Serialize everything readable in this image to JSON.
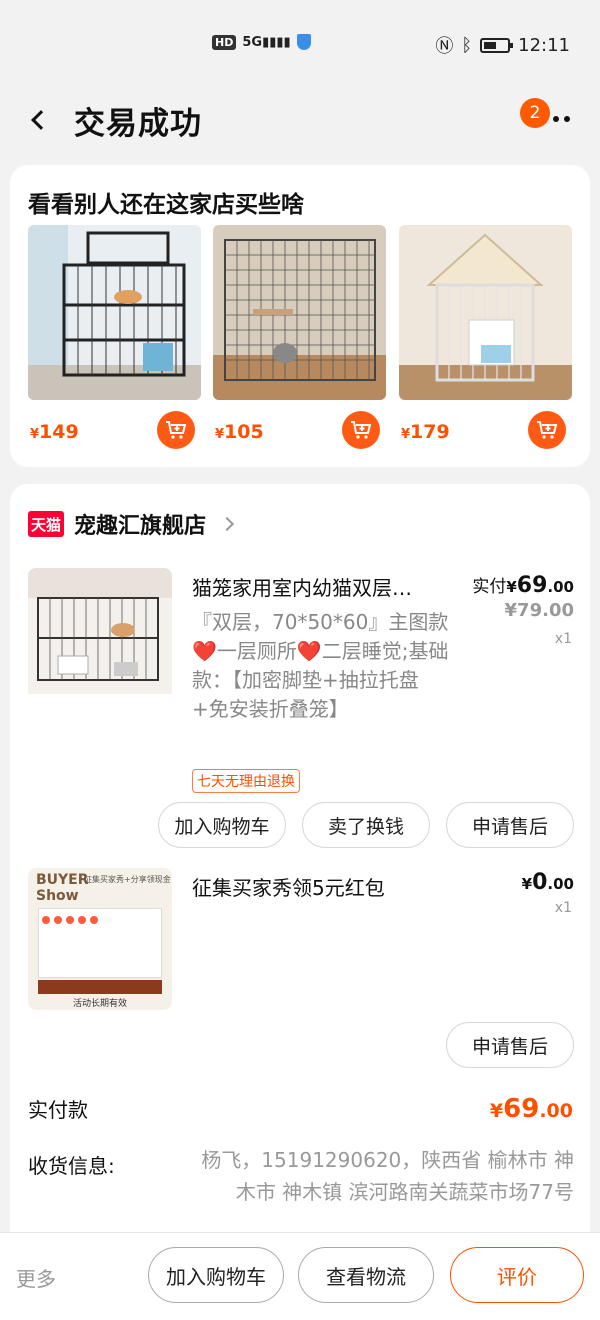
{
  "status_bar": {
    "time": "12:11",
    "network": "5G",
    "hd": "HD"
  },
  "nav": {
    "title": "交易成功",
    "notification_count": "2"
  },
  "recommend": {
    "title": "看看别人还在这家店买些啥",
    "items": [
      {
        "currency": "¥",
        "price": "149"
      },
      {
        "currency": "¥",
        "price": "105"
      },
      {
        "currency": "¥",
        "price": "179"
      }
    ]
  },
  "shop": {
    "logo_text": "天猫",
    "name": "宠趣汇旗舰店"
  },
  "products": [
    {
      "title": "猫笼家用室内幼猫双层…",
      "spec": "『双层，70*50*60』主图款❤️一层厕所❤️二层睡觉;基础款：【加密脚垫+抽拉托盘+免安装折叠笼】",
      "paid_label": "实付",
      "paid_currency": "¥",
      "paid_int": "69",
      "paid_dec": ".00",
      "original_price": "¥79.00",
      "qty": "x1",
      "return_tag": "七天无理由退换",
      "actions": [
        "加入购物车",
        "卖了换钱",
        "申请售后"
      ]
    },
    {
      "title": "征集买家秀领5元红包",
      "paid_currency": "¥",
      "paid_int": "0",
      "paid_dec": ".00",
      "qty": "x1",
      "thumb_text": {
        "line1": "BUYER",
        "line2": "Show",
        "caption": "征集买家秀+分享领现金",
        "footer": "活动长期有效"
      },
      "actions": [
        "申请售后"
      ]
    }
  ],
  "payment": {
    "label": "实付款",
    "currency": "¥",
    "amount_int": "69",
    "amount_dec": ".00"
  },
  "shipping": {
    "label": "收货信息:",
    "value": "杨飞，15191290620，陕西省 榆林市 神木市 神木镇 滨河路南关蔬菜市场77号"
  },
  "bottom_bar": {
    "more": "更多",
    "add_to_cart": "加入购物车",
    "view_logistics": "查看物流",
    "review": "评价"
  },
  "colors": {
    "accent": "#ff5000",
    "tmall": "#ff0036"
  }
}
